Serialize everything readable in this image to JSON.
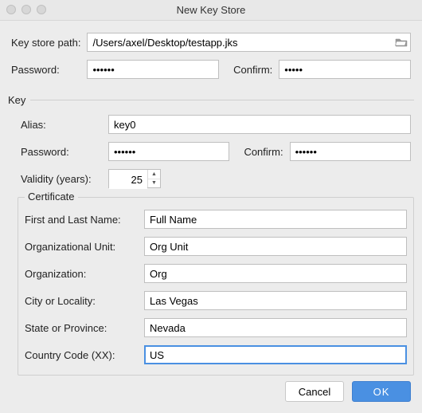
{
  "title": "New Key Store",
  "labels": {
    "keystore_path": "Key store path:",
    "password": "Password:",
    "confirm": "Confirm:",
    "key": "Key",
    "alias": "Alias:",
    "validity": "Validity (years):",
    "certificate": "Certificate",
    "first_last": "First and Last Name:",
    "org_unit": "Organizational Unit:",
    "org": "Organization:",
    "city": "City or Locality:",
    "state": "State or Province:",
    "country": "Country Code (XX):"
  },
  "values": {
    "keystore_path": "/Users/axel/Desktop/testapp.jks",
    "ks_password": "••••••",
    "ks_confirm": "•••••",
    "alias": "key0",
    "key_password": "••••••",
    "key_confirm": "••••••",
    "validity": "25",
    "first_last": "Full Name",
    "org_unit": "Org Unit",
    "org": "Org",
    "city": "Las Vegas",
    "state": "Nevada",
    "country": "US"
  },
  "buttons": {
    "cancel": "Cancel",
    "ok": "OK"
  }
}
